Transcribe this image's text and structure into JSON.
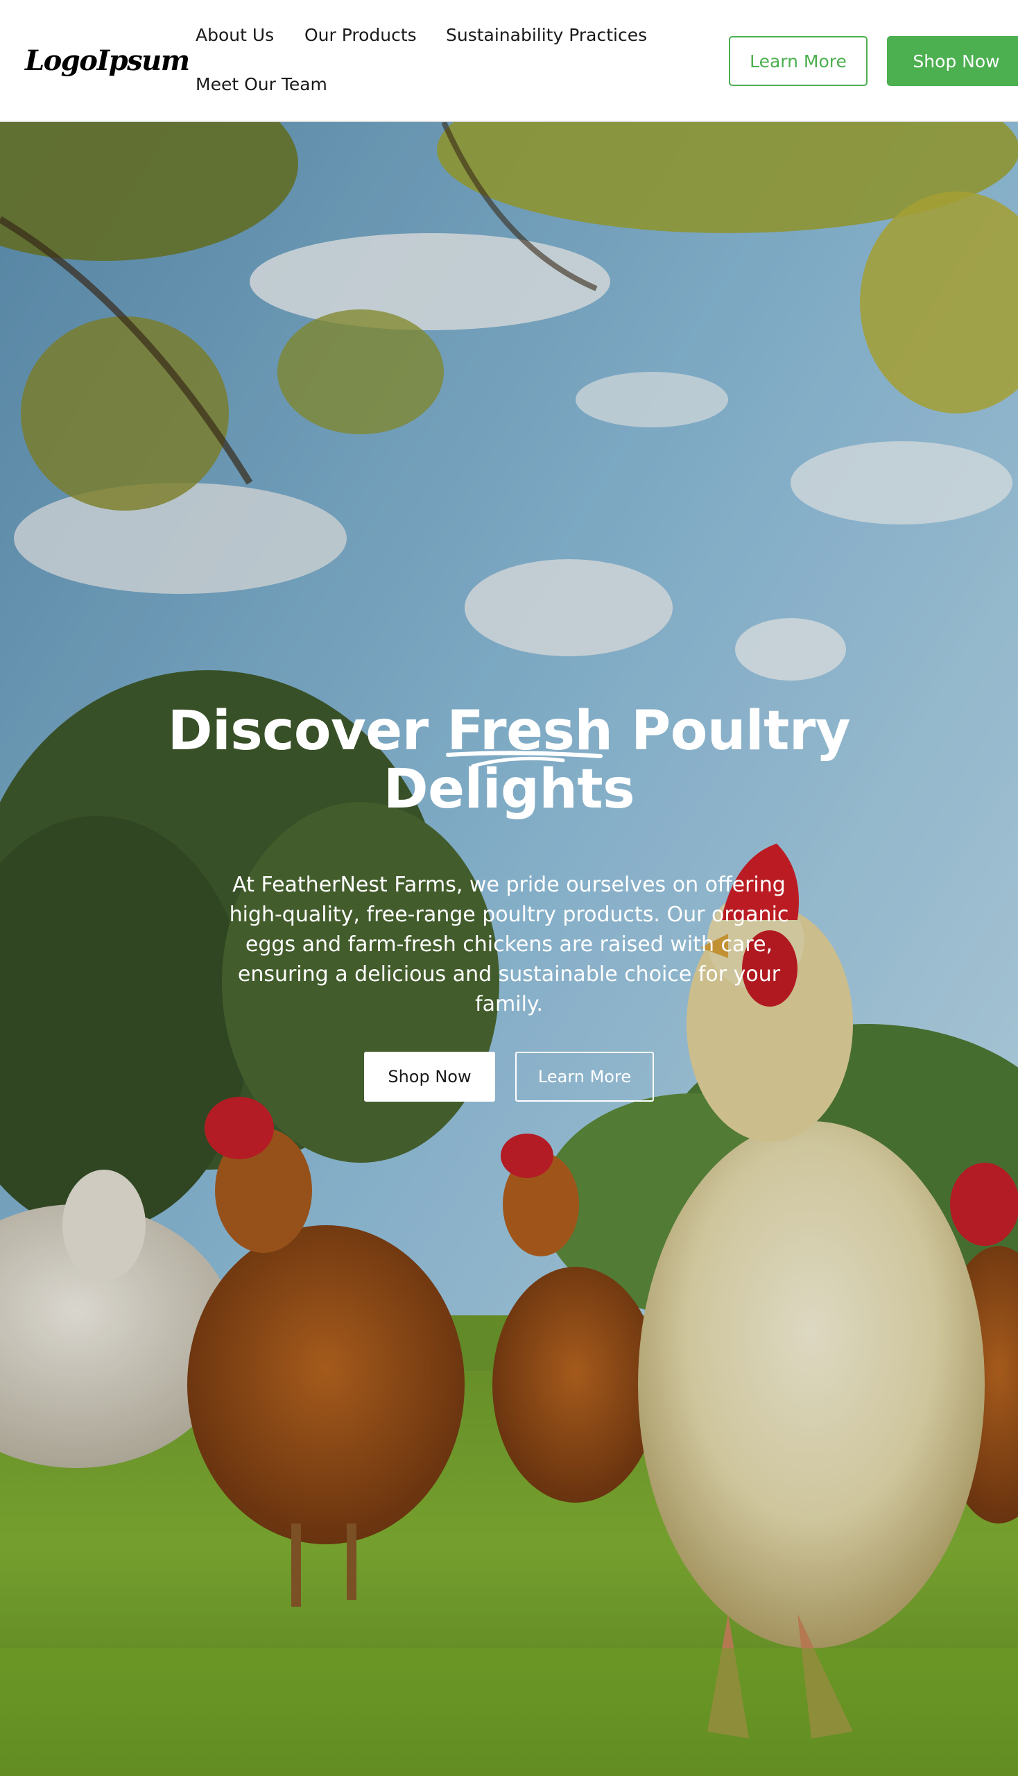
{
  "header": {
    "logo_text": "LogoIpsum",
    "nav": {
      "about": "About Us",
      "products": "Our Products",
      "sustainability": "Sustainability Practices",
      "team": "Meet Our Team"
    },
    "learn_more_label": "Learn More",
    "shop_now_label": "Shop Now"
  },
  "hero": {
    "title_before": "Discover ",
    "title_highlight": "Fresh",
    "title_after": " Poultry Delights",
    "description": "At FeatherNest Farms, we pride ourselves on offering high-quality, free-range poultry products. Our organic eggs and farm-fresh chickens are raised with care, ensuring a delicious and sustainable choice for your family.",
    "shop_now_label": "Shop Now",
    "learn_more_label": "Learn More",
    "background_image": "free-range chickens on green grass under trees and blue sky"
  },
  "colors": {
    "accent_green": "#4caf50",
    "header_bg": "#ffffff",
    "hero_text": "#ffffff"
  }
}
